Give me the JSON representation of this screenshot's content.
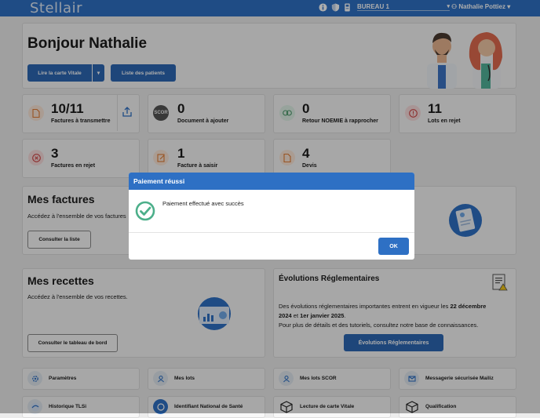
{
  "app": {
    "logo": "Stellair"
  },
  "topbar": {
    "bureau": "BUREAU 1",
    "user": "Nathalie Pottiez",
    "caret": "▾"
  },
  "greeting": "Bonjour Nathalie",
  "actions": {
    "read_card": "Lire la carte Vitale",
    "patients": "Liste des patients"
  },
  "stats": [
    {
      "num": "10/11",
      "label": "Factures à transmettre"
    },
    {
      "num": "0",
      "label": "Document à ajouter"
    },
    {
      "num": "0",
      "label": "Retour NOEMIE à rapprocher"
    },
    {
      "num": "11",
      "label": "Lots en rejet"
    },
    {
      "num": "3",
      "label": "Factures en rejet"
    },
    {
      "num": "1",
      "label": "Facture à saisir"
    },
    {
      "num": "4",
      "label": "Devis"
    }
  ],
  "scor_badge": "SCOR",
  "factures": {
    "title": "Mes factures",
    "text": "Accédez à l'ensemble de vos factures",
    "button": "Consulter la liste"
  },
  "recettes": {
    "title": "Mes recettes",
    "text": "Accédez à l'ensemble de vos recettes.",
    "button": "Consulter le tableau de bord"
  },
  "evolutions": {
    "title": "Évolutions Réglementaires",
    "t1": "Des évolutions réglementaires importantes entrent en vigueur les ",
    "b1": "22 décembre",
    "b2": "2024",
    "t2": " et ",
    "b3": "1er janvier 2025",
    "t3": ".",
    "t4": "Pour plus de détails et des tutoriels, consultez notre base de connaissances.",
    "button": "Évolutions Réglementaires"
  },
  "quick": [
    {
      "label": "Paramètres"
    },
    {
      "label": "Mes lots"
    },
    {
      "label": "Mes lots SCOR"
    },
    {
      "label": "Messagerie sécurisée Mailiz"
    },
    {
      "label": "Historique TLSi"
    },
    {
      "label": "Identifiant National de Santé"
    },
    {
      "label": "Lecture de carte Vitale"
    },
    {
      "label": "Qualification"
    }
  ],
  "modal": {
    "title": "Paiement réussi",
    "message": "Paiement effectué avec succès",
    "ok": "OK"
  },
  "colors": {
    "primary": "#2e70c4",
    "button": "#2d68b4",
    "success": "#4caf8a",
    "overlay": "rgba(0,0,0,0.32)"
  }
}
